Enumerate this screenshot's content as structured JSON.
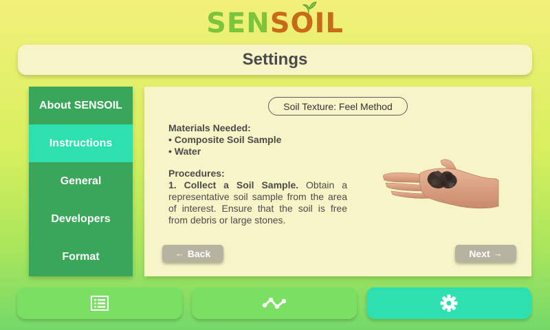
{
  "app": {
    "logo_text_part1": "SEN",
    "logo_text_part2": "S",
    "logo_text_part3": "O",
    "logo_text_part4": "IL",
    "brand_green": "#7cc43b",
    "brand_brown": "#c86a17"
  },
  "header": {
    "title": "Settings"
  },
  "sidebar": {
    "items": [
      {
        "label": "About SENSOIL"
      },
      {
        "label": "Instructions",
        "active": true
      },
      {
        "label": "General"
      },
      {
        "label": "Developers"
      },
      {
        "label": "Format"
      }
    ],
    "color": "#3aa65a",
    "active_color": "#2ee0b0"
  },
  "content": {
    "topic": "Soil Texture: Feel Method",
    "materials_heading": "Materials Needed:",
    "materials": [
      "• Composite Soil Sample",
      "• Water"
    ],
    "procedures_heading": "Procedures:",
    "step_number": "1.",
    "step_title": "Collect a Soil Sample.",
    "step_text": "Obtain a representative soil sample from the area of interest. Ensure that the soil is free from debris or large stones.",
    "image_icon": "hand-holding-soil",
    "back_label": "Back",
    "next_label": "Next"
  },
  "bottom_nav": {
    "items": [
      {
        "icon": "list-icon"
      },
      {
        "icon": "graph-icon"
      },
      {
        "icon": "gear-icon",
        "active": true
      }
    ]
  }
}
